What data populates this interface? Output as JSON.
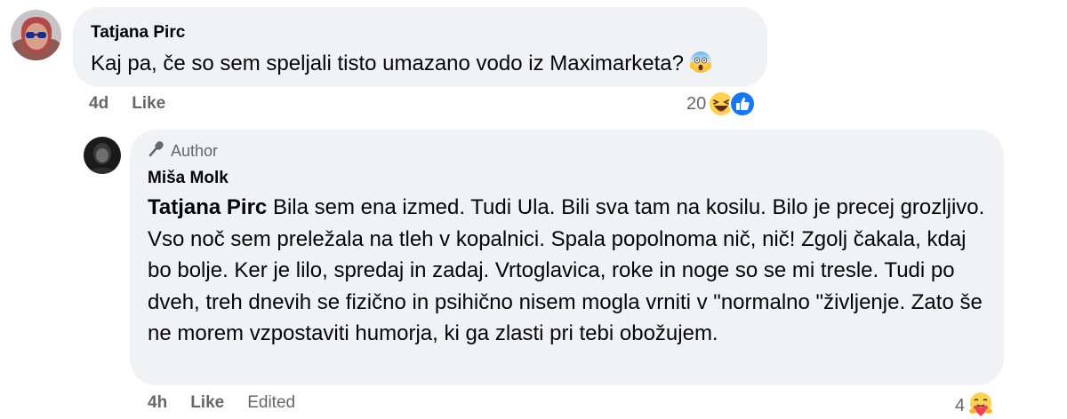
{
  "comments": [
    {
      "author": "Tatjana Pirc",
      "text": "Kaj pa, če so sem speljali tisto umazano vodo iz Maximarketa?",
      "emoji": "face-screaming-in-fear",
      "time": "4d",
      "like_label": "Like",
      "reaction_count": "20",
      "reactions": [
        "haha",
        "like"
      ]
    },
    {
      "badge": "Author",
      "author": "Miša Molk",
      "mention": "Tatjana Pirc",
      "text": "Bila sem ena izmed. Tudi Ula. Bili sva tam na kosilu. Bilo je precej grozljivo. Vso noč sem preležala na tleh v kopalnici. Spala popolnoma nič, nič! Zgolj čakala, kdaj bo bolje. Ker je lilo, spredaj in zadaj. Vrtoglavica, roke in noge so se mi tresle. Tudi po dveh, treh dnevih se fizično in psihično nisem mogla vrniti v \"normalno \"življenje. Zato še ne morem vzpostaviti humorja, ki ga zlasti pri tebi obožujem.",
      "time": "4h",
      "like_label": "Like",
      "edited_label": "Edited",
      "reaction_count": "4",
      "reactions": [
        "care"
      ]
    }
  ]
}
